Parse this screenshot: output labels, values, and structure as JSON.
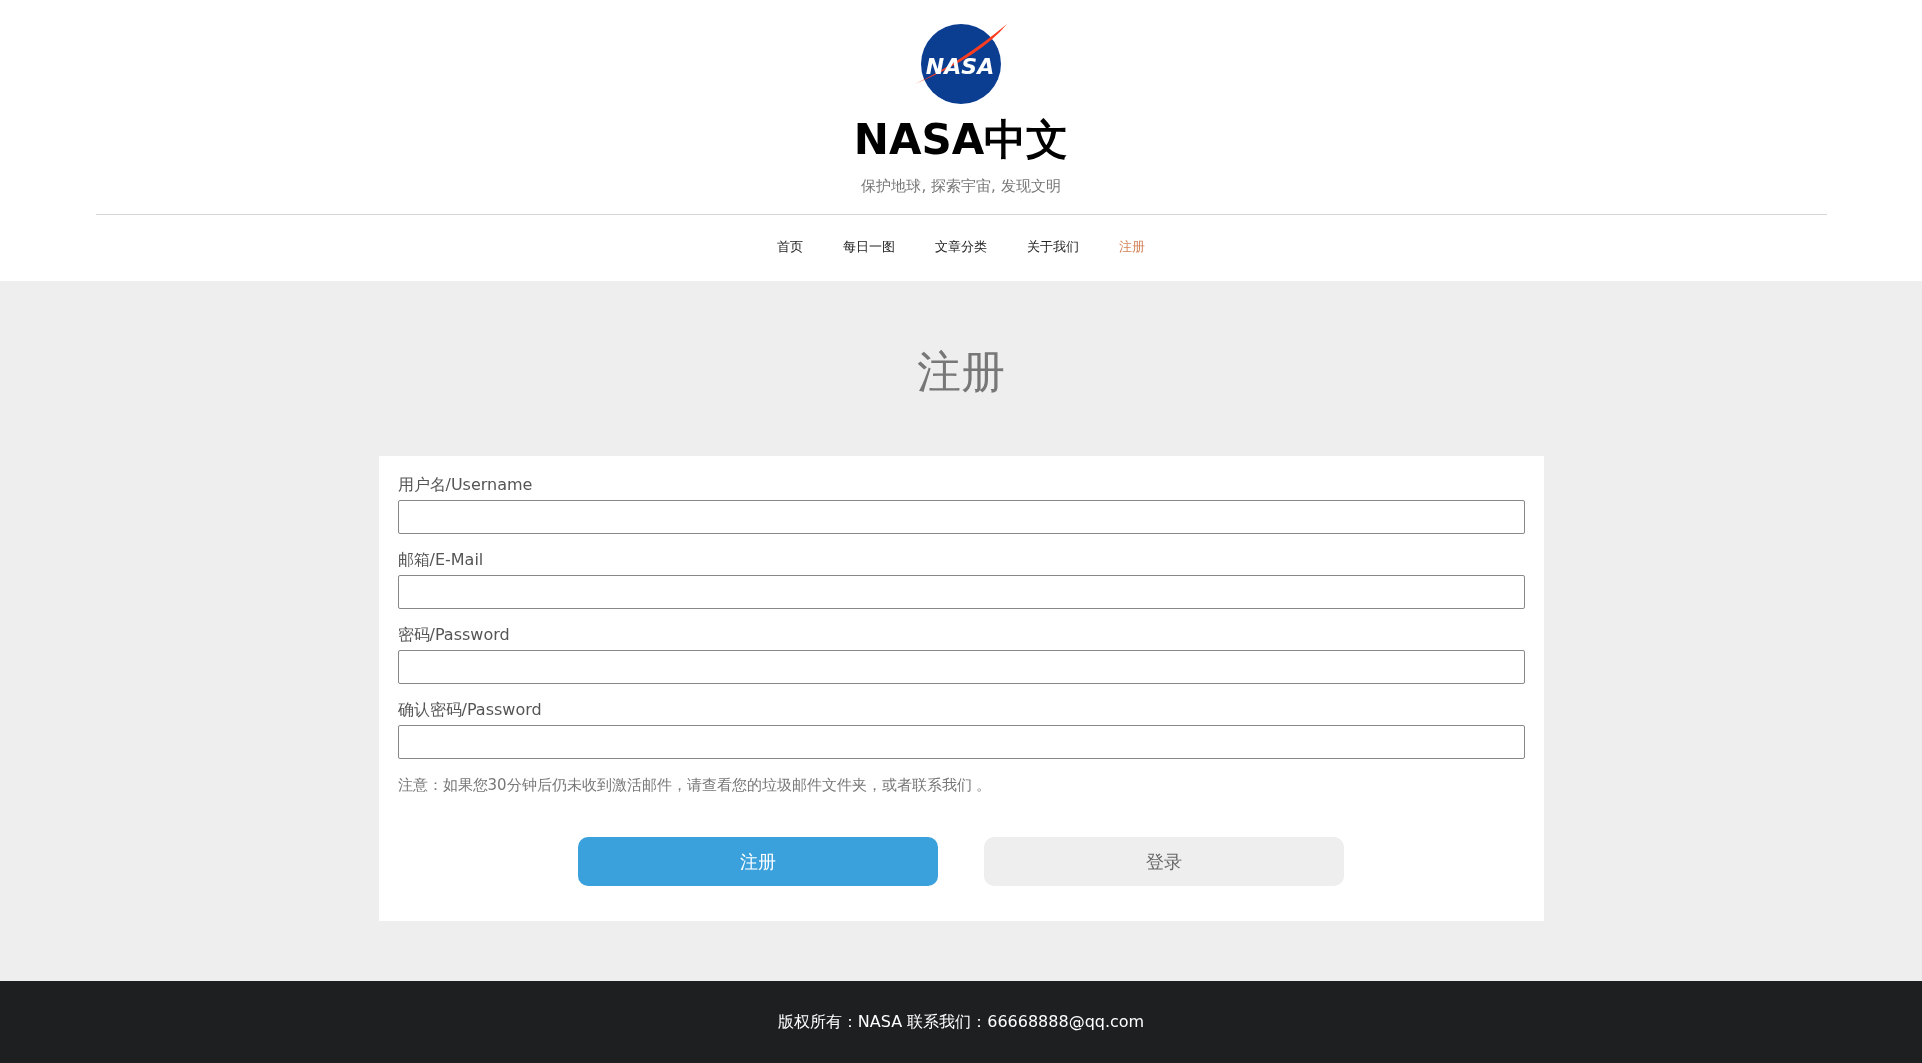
{
  "header": {
    "logo_text": "NASA",
    "site_title": "NASA中文",
    "tagline": "保护地球, 探索宇宙, 发现文明"
  },
  "nav": [
    {
      "label": "首页",
      "selected": false
    },
    {
      "label": "每日一图",
      "selected": false
    },
    {
      "label": "文章分类",
      "selected": false
    },
    {
      "label": "关于我们",
      "selected": false
    },
    {
      "label": "注册",
      "selected": true
    }
  ],
  "page_heading": "注册",
  "form": {
    "fields": [
      {
        "label": "用户名/Username"
      },
      {
        "label": "邮箱/E-Mail"
      },
      {
        "label": "密码/Password"
      },
      {
        "label": "确认密码/Password"
      }
    ],
    "note": "注意：如果您30分钟后仍未收到激活邮件，请查看您的垃圾邮件文件夹，或者联系我们 。",
    "buttons": [
      {
        "label": "注册",
        "kind": "primary"
      },
      {
        "label": "登录",
        "kind": "secondary"
      }
    ]
  },
  "footer": "版权所有：NASA 联系我们：66668888@qq.com"
}
